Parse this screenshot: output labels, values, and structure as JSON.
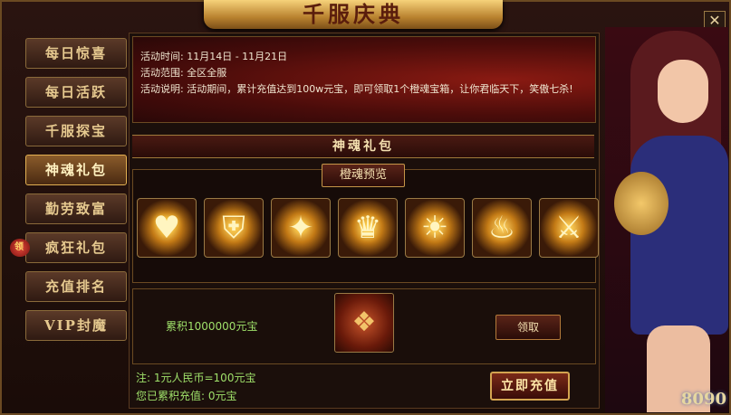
{
  "window": {
    "title": "千服庆典",
    "close_glyph": "✕"
  },
  "sidebar": {
    "items": [
      {
        "label": "每日惊喜"
      },
      {
        "label": "每日活跃"
      },
      {
        "label": "千服探宝"
      },
      {
        "label": "神魂礼包",
        "active": true
      },
      {
        "label": "勤劳致富"
      },
      {
        "label": "疯狂礼包",
        "badge": "领"
      },
      {
        "label": "充值排名"
      },
      {
        "label": "VIP封魔"
      }
    ]
  },
  "info": {
    "time": "活动时间: 11月14日 - 11月21日",
    "range": "活动范围: 全区全服",
    "desc": "活动说明: 活动期间，累计充值达到100w元宝，即可领取1个橙魂宝箱，让你君临天下，笑傲七杀!"
  },
  "section_title": "神魂礼包",
  "preview_tab": "橙魂预览",
  "soul_icons": [
    "heart-soul-icon",
    "shield-soul-icon",
    "crest-soul-icon",
    "crown-soul-icon",
    "sun-soul-icon",
    "flame-soul-icon",
    "sword-soul-icon"
  ],
  "reward": {
    "text": "累积1000000元宝",
    "claim_label": "领取",
    "chest_icon": "treasure-chest-icon"
  },
  "notes": {
    "rate": "注: 1元人民币=100元宝",
    "total": "您已累积充值: 0元宝"
  },
  "recharge_label": "立即充值",
  "character": {
    "logo": "8090"
  }
}
